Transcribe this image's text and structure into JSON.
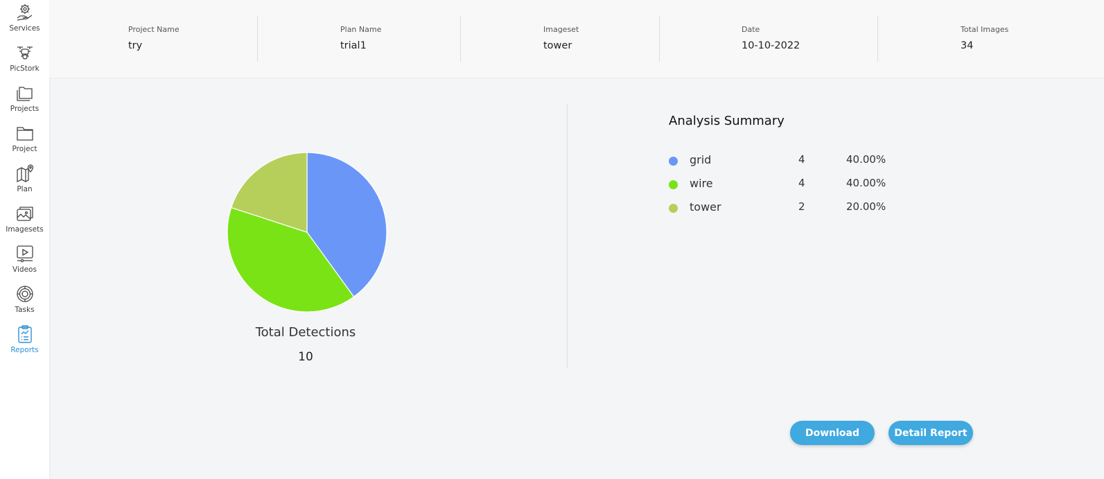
{
  "sidebar": {
    "items": [
      {
        "label": "Services",
        "icon": "services-icon"
      },
      {
        "label": "PicStork",
        "icon": "drone-icon"
      },
      {
        "label": "Projects",
        "icon": "folders-icon"
      },
      {
        "label": "Project",
        "icon": "folder-icon"
      },
      {
        "label": "Plan",
        "icon": "map-pin-icon"
      },
      {
        "label": "Imagesets",
        "icon": "images-icon"
      },
      {
        "label": "Videos",
        "icon": "video-icon"
      },
      {
        "label": "Tasks",
        "icon": "gear-icon"
      },
      {
        "label": "Reports",
        "icon": "report-clipboard-icon",
        "active": true
      }
    ],
    "active_color": "#2d8fd5"
  },
  "info": {
    "project_name": {
      "label": "Project Name",
      "value": "try"
    },
    "plan_name": {
      "label": "Plan Name",
      "value": "trial1"
    },
    "imageset": {
      "label": "Imageset",
      "value": "tower"
    },
    "date": {
      "label": "Date",
      "value": "10-10-2022"
    },
    "total_images": {
      "label": "Total Images",
      "value": "34"
    }
  },
  "chart_data": {
    "type": "pie",
    "categories": [
      "grid",
      "wire",
      "tower"
    ],
    "values": [
      4,
      4,
      2
    ],
    "colors": [
      "#6a97f7",
      "#7ae316",
      "#b5cf5a"
    ]
  },
  "totals": {
    "label": "Total Detections",
    "value": "10"
  },
  "summary": {
    "title": "Analysis Summary",
    "rows": [
      {
        "name": "grid",
        "count": "4",
        "percent": "40.00%",
        "color": "#6a97f7"
      },
      {
        "name": "wire",
        "count": "4",
        "percent": "40.00%",
        "color": "#7ae316"
      },
      {
        "name": "tower",
        "count": "2",
        "percent": "20.00%",
        "color": "#b5cf5a"
      }
    ]
  },
  "actions": {
    "download": "Download",
    "detail_report": "Detail Report"
  }
}
